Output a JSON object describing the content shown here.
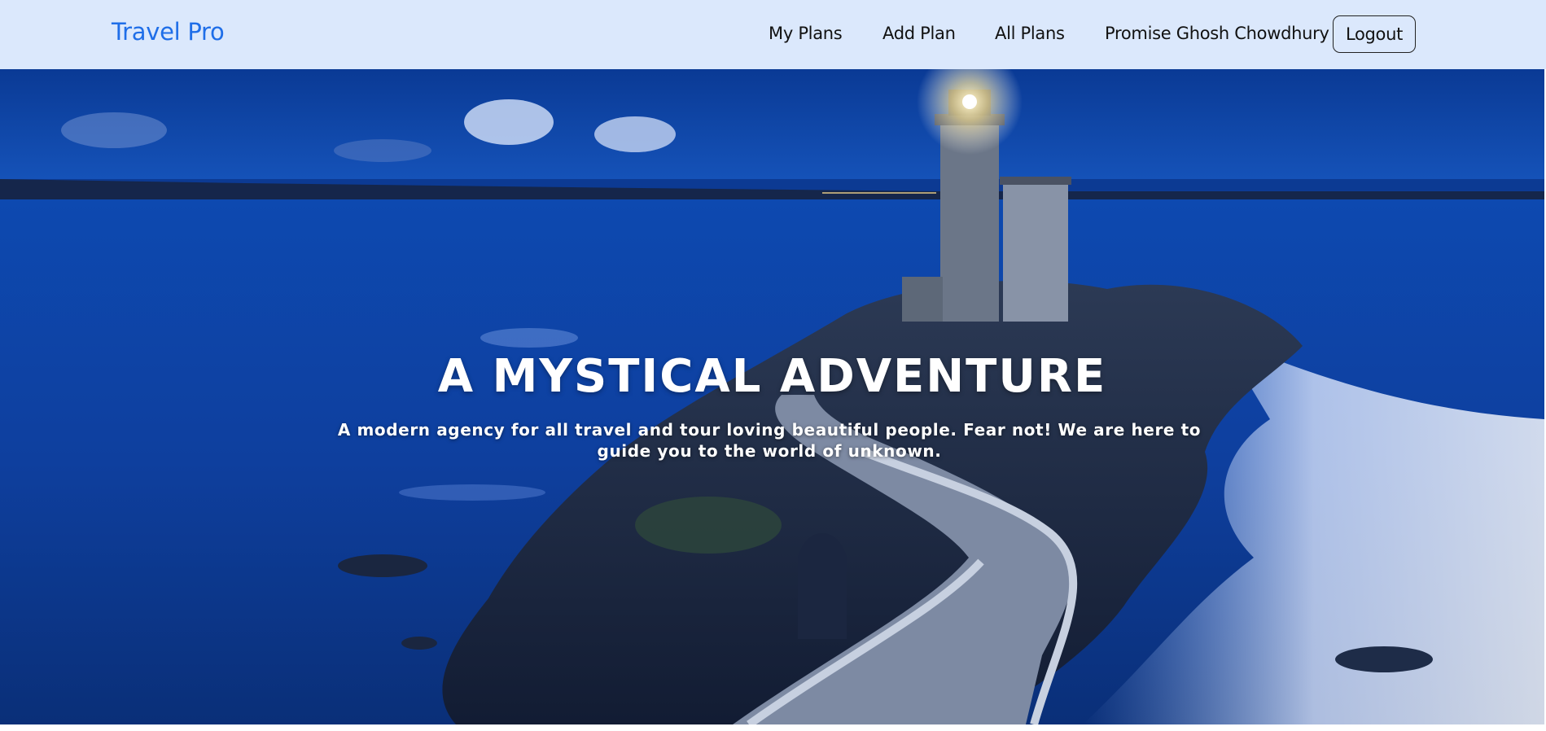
{
  "navbar": {
    "brand": "Travel Pro",
    "links": [
      "My Plans",
      "Add Plan",
      "All Plans"
    ],
    "user_name": "Promise Ghosh Chowdhury",
    "logout_label": "Logout"
  },
  "hero": {
    "title": "A MYSTICAL ADVENTURE",
    "subtitle": "A modern agency for all travel and tour loving beautiful people. Fear not! We are here to guide you to the world of unknown."
  },
  "colors": {
    "navbar_bg": "#dbe8fc",
    "brand": "#1f6ee8",
    "hero_sky": "#0c3a93"
  }
}
